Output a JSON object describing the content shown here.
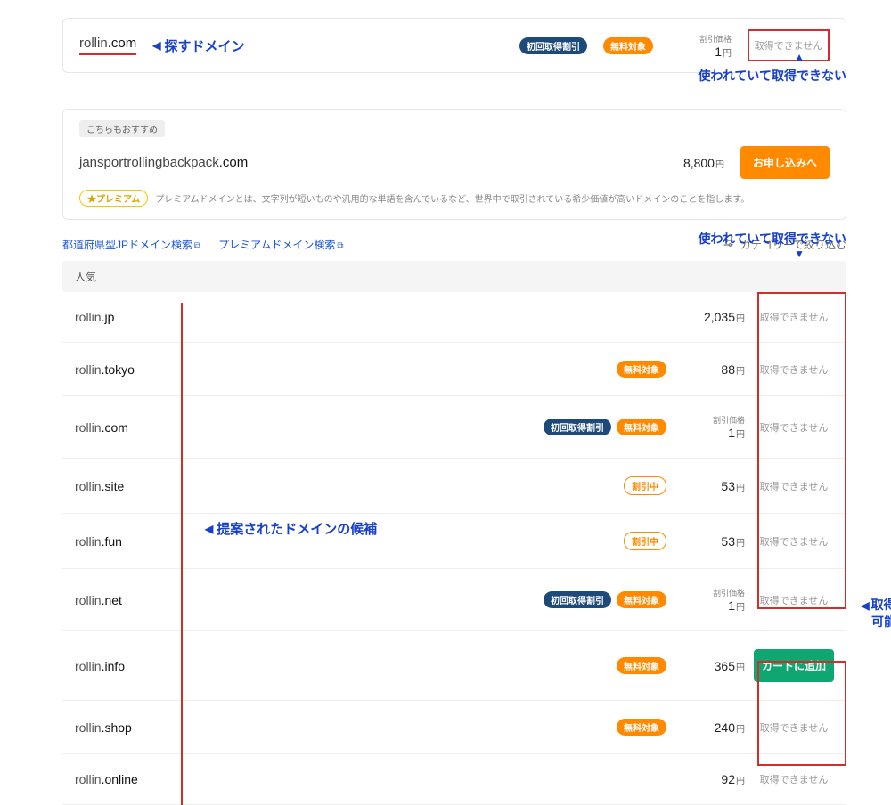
{
  "top": {
    "domain_prefix": "rollin",
    "domain_tld": ".com",
    "callout": "探すドメイン",
    "badge_first": "初回取得割引",
    "badge_free": "無料対象",
    "price_label": "割引価格",
    "price": "1",
    "yen": "円",
    "status": "取得できません"
  },
  "annotations": {
    "unavailable": "使われていて取得できない",
    "candidates": "提案されたドメインの候補",
    "available_l1": "取得",
    "available_l2": "可能"
  },
  "recommend": {
    "badge": "こちらもおすすめ",
    "domain_prefix": "jansportrollingbackpack",
    "domain_tld": ".com",
    "price": "8,800",
    "yen": "円",
    "buy": "お申し込みへ",
    "premium_tag": "プレミアム",
    "premium_text": "プレミアムドメインとは、文字列が短いものや汎用的な単語を含んでいるなど、世界中で取引されている希少価値が高いドメインのことを指します。"
  },
  "links": {
    "pref_jp": "都道府県型JPドメイン検索",
    "premium": "プレミアムドメイン検索",
    "ext": "⧉",
    "category_filter": "カテゴリーで絞り込む"
  },
  "section_popular": "人気",
  "badges": {
    "first": "初回取得割引",
    "free": "無料対象",
    "sale": "割引中"
  },
  "labels": {
    "disc_price": "割引価格",
    "yen": "円",
    "unavailable": "取得できません",
    "add_cart": "カートに追加"
  },
  "rows": [
    {
      "prefix": "rollin",
      "tld": ".jp",
      "badges": [],
      "price_label": "",
      "price": "2,035",
      "status": "unavail"
    },
    {
      "prefix": "rollin",
      "tld": ".tokyo",
      "badges": [
        "free"
      ],
      "price_label": "",
      "price": "88",
      "status": "unavail"
    },
    {
      "prefix": "rollin",
      "tld": ".com",
      "badges": [
        "first",
        "free"
      ],
      "price_label": "disc",
      "price": "1",
      "status": "unavail"
    },
    {
      "prefix": "rollin",
      "tld": ".site",
      "badges": [
        "sale"
      ],
      "price_label": "",
      "price": "53",
      "status": "unavail"
    },
    {
      "prefix": "rollin",
      "tld": ".fun",
      "badges": [
        "sale"
      ],
      "price_label": "",
      "price": "53",
      "status": "unavail"
    },
    {
      "prefix": "rollin",
      "tld": ".net",
      "badges": [
        "first",
        "free"
      ],
      "price_label": "disc",
      "price": "1",
      "status": "unavail"
    },
    {
      "prefix": "rollin",
      "tld": ".info",
      "badges": [
        "free"
      ],
      "price_label": "",
      "price": "365",
      "status": "avail"
    },
    {
      "prefix": "rollin",
      "tld": ".shop",
      "badges": [
        "free"
      ],
      "price_label": "",
      "price": "240",
      "status": "unavail"
    },
    {
      "prefix": "rollin",
      "tld": ".online",
      "badges": [],
      "price_label": "",
      "price": "92",
      "status": "unavail"
    }
  ]
}
